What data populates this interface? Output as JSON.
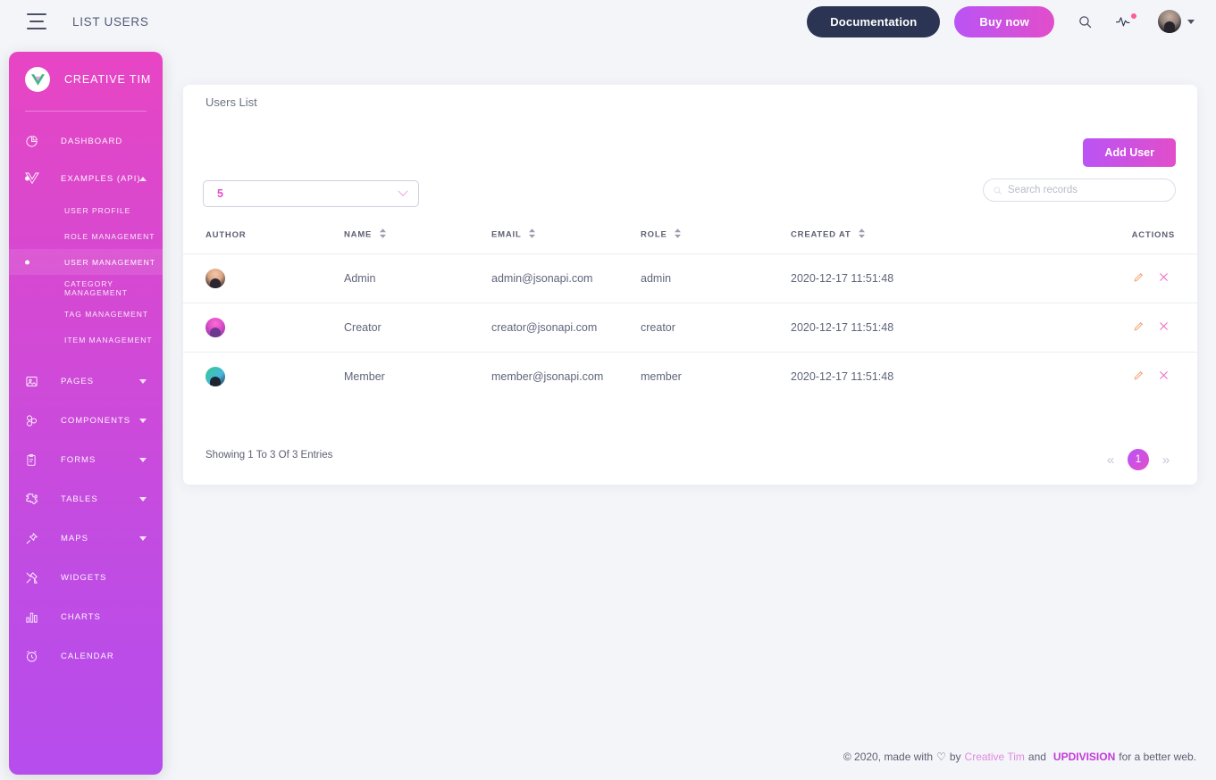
{
  "navbar": {
    "menu_icon": "hamburger-icon",
    "title": "LIST USERS",
    "documentation_label": "Documentation",
    "buy_now_label": "Buy now",
    "search_icon": "search-icon",
    "activity_icon": "pulse-icon",
    "avatar": "user-avatar"
  },
  "sidebar": {
    "brand": "CREATIVE TIM",
    "brand_logo": "vue-logo-icon",
    "items": [
      {
        "label": "DASHBOARD",
        "icon": "pie-chart-icon",
        "has_caret": false
      },
      {
        "label": "EXAMPLES (API)",
        "icon": "vue-icon",
        "has_caret": true,
        "expanded": true,
        "dot": true
      },
      {
        "label": "PAGES",
        "icon": "image-icon",
        "has_caret": true
      },
      {
        "label": "COMPONENTS",
        "icon": "molecule-icon",
        "has_caret": true
      },
      {
        "label": "FORMS",
        "icon": "clipboard-icon",
        "has_caret": true
      },
      {
        "label": "TABLES",
        "icon": "puzzle-icon",
        "has_caret": true
      },
      {
        "label": "MAPS",
        "icon": "pin-icon",
        "has_caret": true
      },
      {
        "label": "WIDGETS",
        "icon": "tools-icon",
        "has_caret": false
      },
      {
        "label": "CHARTS",
        "icon": "bar-chart-icon",
        "has_caret": false
      },
      {
        "label": "CALENDAR",
        "icon": "alarm-clock-icon",
        "has_caret": false
      }
    ],
    "submenu": [
      {
        "label": "USER PROFILE",
        "active": false
      },
      {
        "label": "ROLE MANAGEMENT",
        "active": false
      },
      {
        "label": "USER MANAGEMENT",
        "active": true
      },
      {
        "label": "CATEGORY MANAGEMENT",
        "active": false
      },
      {
        "label": "TAG MANAGEMENT",
        "active": false
      },
      {
        "label": "ITEM MANAGEMENT",
        "active": false
      }
    ]
  },
  "card": {
    "title": "Users List",
    "settings_icon": "gear-icon",
    "add_user_label": "Add User",
    "page_size_value": "5",
    "search_placeholder": "Search records",
    "search_value": "",
    "columns": [
      {
        "label": "AUTHOR",
        "sortable": false
      },
      {
        "label": "NAME",
        "sortable": true
      },
      {
        "label": "EMAIL",
        "sortable": true
      },
      {
        "label": "ROLE",
        "sortable": true
      },
      {
        "label": "CREATED AT",
        "sortable": true
      },
      {
        "label": "ACTIONS",
        "sortable": false
      }
    ],
    "rows": [
      {
        "avatar": "avatar-admin",
        "name": "Admin",
        "email": "admin@jsonapi.com",
        "role": "admin",
        "created_at": "2020-12-17 11:51:48"
      },
      {
        "avatar": "avatar-creator",
        "name": "Creator",
        "email": "creator@jsonapi.com",
        "role": "creator",
        "created_at": "2020-12-17 11:51:48"
      },
      {
        "avatar": "avatar-member",
        "name": "Member",
        "email": "member@jsonapi.com",
        "role": "member",
        "created_at": "2020-12-17 11:51:48"
      }
    ],
    "showing_text": "Showing 1 To 3 Of 3 Entries",
    "pagination": {
      "prev": "«",
      "current": "1",
      "next": "»"
    }
  },
  "footer": {
    "copyright": "© 2020, made with",
    "by": "by",
    "creative_tim": "Creative Tim",
    "and": "and",
    "updivision": "UPDIVISION",
    "tail": "for a better web."
  },
  "colors": {
    "accent_pink": "#e14eca",
    "accent_purple": "#ba54f5",
    "dark_navy": "#2b3553",
    "page_bg": "#f4f5f9",
    "edit_orange": "#f5a67a",
    "delete_pink": "#ec6fc4"
  }
}
